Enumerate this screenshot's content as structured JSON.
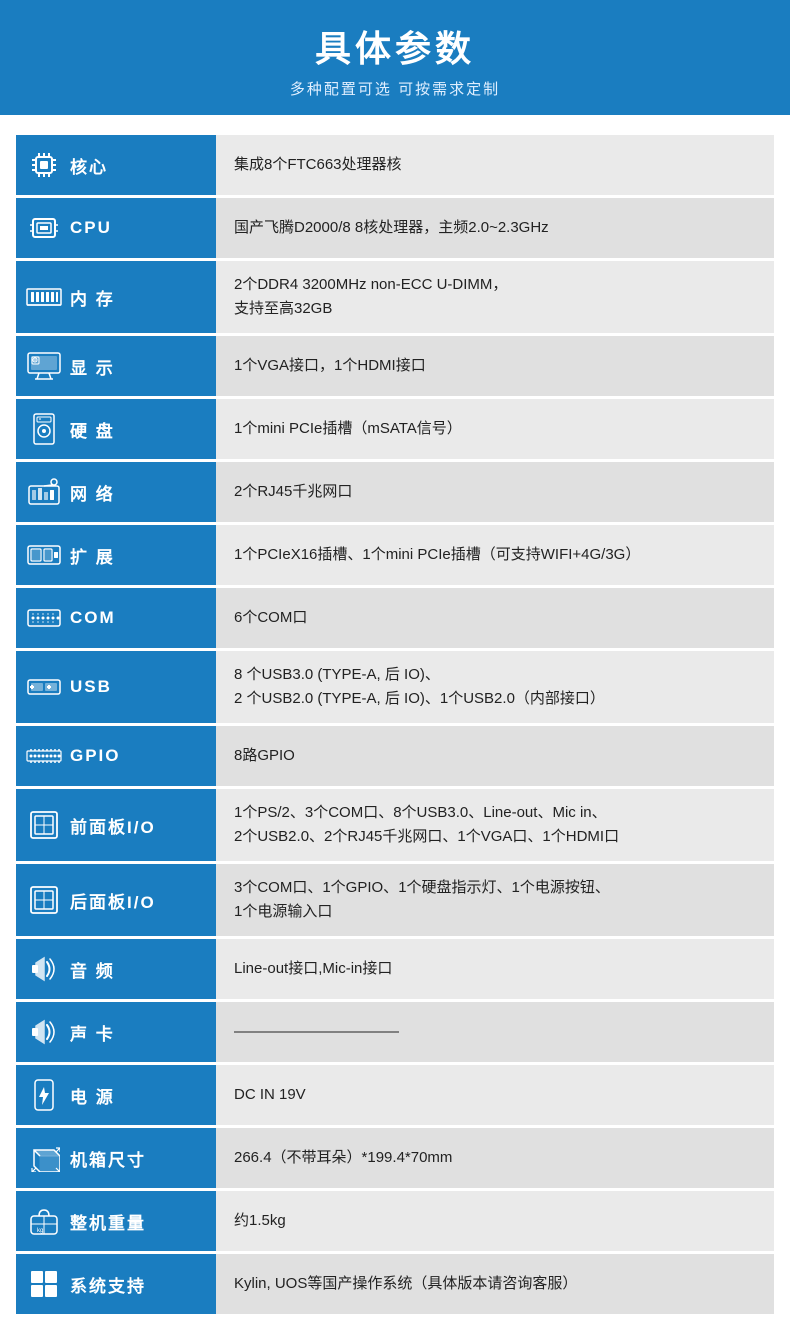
{
  "header": {
    "title": "具体参数",
    "subtitle": "多种配置可选 可按需求定制"
  },
  "rows": [
    {
      "id": "core",
      "icon": "cpu-chip-icon",
      "icon_char": "▦",
      "label": "核心",
      "value": "集成8个FTC663处理器核"
    },
    {
      "id": "cpu",
      "icon": "cpu-icon",
      "icon_char": "⬚",
      "label": "CPU",
      "value": "国产飞腾D2000/8  8核处理器，主频2.0~2.3GHz"
    },
    {
      "id": "memory",
      "icon": "memory-icon",
      "icon_char": "▬",
      "label": "内  存",
      "value": "2个DDR4 3200MHz non-ECC U-DIMM，\n支持至高32GB"
    },
    {
      "id": "display",
      "icon": "display-icon",
      "icon_char": "▣",
      "label": "显  示",
      "value": "1个VGA接口，1个HDMI接口"
    },
    {
      "id": "hdd",
      "icon": "hdd-icon",
      "icon_char": "◉",
      "label": "硬  盘",
      "value": "1个mini PCIe插槽（mSATA信号）"
    },
    {
      "id": "network",
      "icon": "network-icon",
      "icon_char": "⬡",
      "label": "网  络",
      "value": "2个RJ45千兆网口"
    },
    {
      "id": "expand",
      "icon": "expand-icon",
      "icon_char": "▤",
      "label": "扩  展",
      "value": "1个PCIeX16插槽、1个mini PCIe插槽（可支持WIFI+4G/3G）"
    },
    {
      "id": "com",
      "icon": "com-icon",
      "icon_char": "≡",
      "label": "COM",
      "value": "6个COM口"
    },
    {
      "id": "usb",
      "icon": "usb-icon",
      "icon_char": "⇌",
      "label": "USB",
      "value": "8 个USB3.0 (TYPE-A, 后 IO)、\n2 个USB2.0 (TYPE-A, 后 IO)、1个USB2.0（内部接口）"
    },
    {
      "id": "gpio",
      "icon": "gpio-icon",
      "icon_char": "⣿",
      "label": "GPIO",
      "value": "8路GPIO"
    },
    {
      "id": "front-io",
      "icon": "front-panel-icon",
      "icon_char": "▢",
      "label": "前面板I/O",
      "value": "1个PS/2、3个COM口、8个USB3.0、Line-out、Mic in、\n2个USB2.0、2个RJ45千兆网口、1个VGA口、1个HDMI口"
    },
    {
      "id": "rear-io",
      "icon": "rear-panel-icon",
      "icon_char": "▢",
      "label": "后面板I/O",
      "value": "3个COM口、1个GPIO、1个硬盘指示灯、1个电源按钮、\n1个电源输入口"
    },
    {
      "id": "audio",
      "icon": "audio-icon",
      "icon_char": "◀",
      "label": "音  频",
      "value": "Line-out接口,Mic-in接口"
    },
    {
      "id": "sound-card",
      "icon": "sound-card-icon",
      "icon_char": "◀",
      "label": "声  卡",
      "value": "———————————"
    },
    {
      "id": "power",
      "icon": "power-icon",
      "icon_char": "⚡",
      "label": "电  源",
      "value": "DC IN 19V"
    },
    {
      "id": "chassis-size",
      "icon": "chassis-icon",
      "icon_char": "✦",
      "label": "机箱尺寸",
      "value": "266.4（不带耳朵）*199.4*70mm"
    },
    {
      "id": "weight",
      "icon": "weight-icon",
      "icon_char": "⚖",
      "label": "整机重量",
      "value": "约1.5kg"
    },
    {
      "id": "os",
      "icon": "os-icon",
      "icon_char": "⊞",
      "label": "系统支持",
      "value": "Kylin, UOS等国产操作系统（具体版本请咨询客服）"
    }
  ],
  "colors": {
    "primary": "#1a7dc0",
    "row_odd": "#eaeaea",
    "row_even": "#e0e0e0",
    "label_text": "#ffffff",
    "value_text": "#222222"
  }
}
